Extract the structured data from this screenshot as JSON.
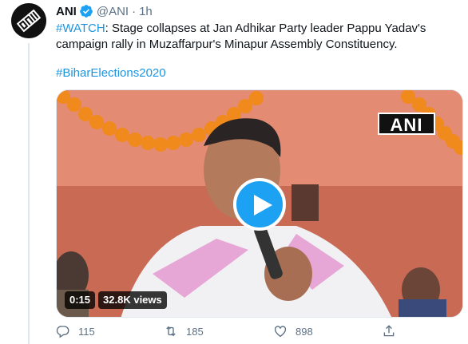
{
  "tweet": {
    "author_name": "ANI",
    "handle": "@ANI",
    "separator": "·",
    "time": "1h",
    "text": {
      "hashtag_watch": "#WATCH",
      "body": ": Stage collapses at Jan Adhikar Party leader Pappu Yadav's campaign rally in Muzaffarpur's Minapur Assembly Constituency."
    },
    "hashtag_line": "#BiharElections2020",
    "media": {
      "watermark": "ANI",
      "duration": "0:15",
      "views": "32.8K views"
    },
    "actions": {
      "reply_count": "115",
      "retweet_count": "185",
      "like_count": "898"
    }
  },
  "colors": {
    "link": "#1b95e0",
    "play_button": "#1da1f2",
    "secondary_text": "#5b7083",
    "verified": "#1da1f2"
  },
  "icons": {
    "verified": "verified-badge-icon",
    "play": "play-icon",
    "reply": "reply-icon",
    "retweet": "retweet-icon",
    "like": "heart-icon",
    "share": "share-icon"
  }
}
